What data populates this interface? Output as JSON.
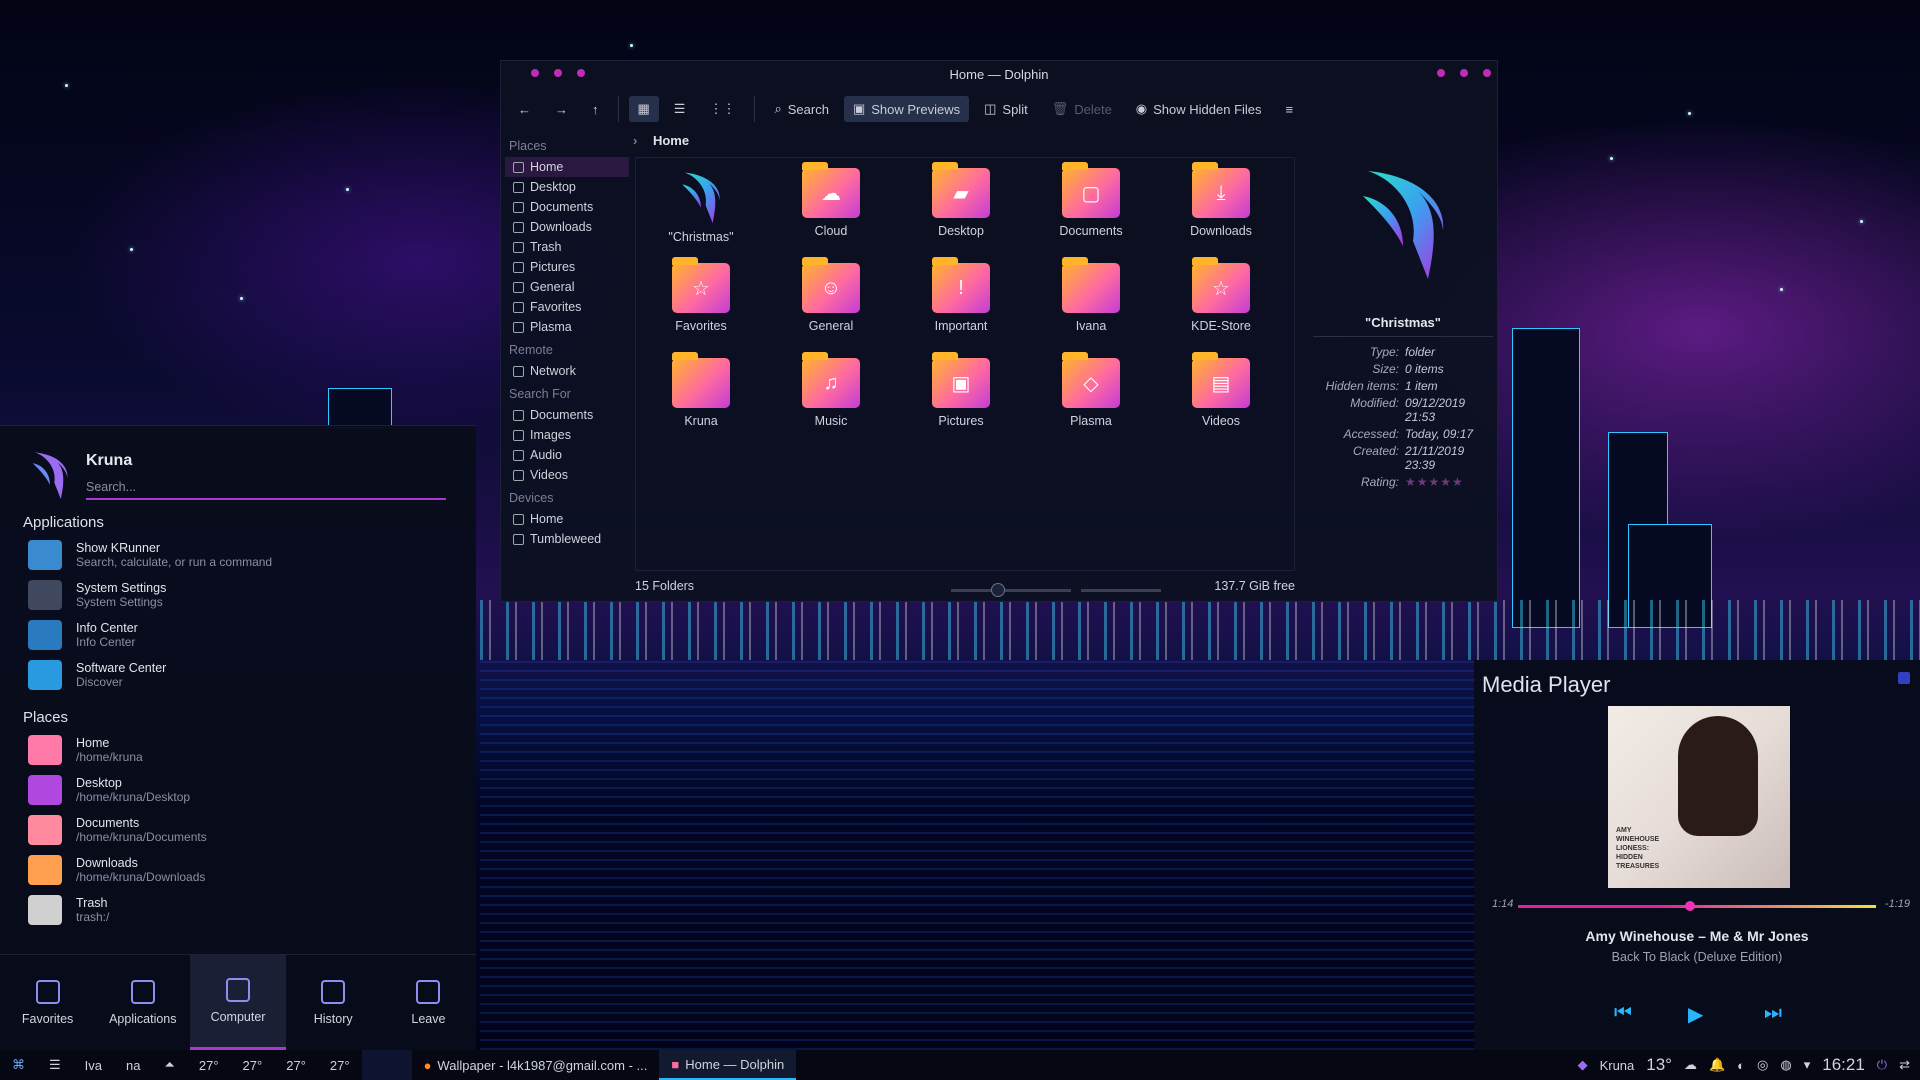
{
  "dolphin": {
    "window_title": "Home — Dolphin",
    "toolbar": {
      "search": "Search",
      "show_previews": "Show Previews",
      "split": "Split",
      "delete": "Delete",
      "show_hidden": "Show Hidden Files"
    },
    "breadcrumb": "Home",
    "places_sections": [
      {
        "title": "Places",
        "items": [
          "Home",
          "Desktop",
          "Documents",
          "Downloads",
          "Trash",
          "Pictures",
          "General",
          "Favorites",
          "Plasma"
        ]
      },
      {
        "title": "Remote",
        "items": [
          "Network"
        ]
      },
      {
        "title": "Search For",
        "items": [
          "Documents",
          "Images",
          "Audio",
          "Videos"
        ]
      },
      {
        "title": "Devices",
        "items": [
          "Home",
          "Tumbleweed"
        ]
      }
    ],
    "files": [
      {
        "name": "\"Christmas\"",
        "icon": "kde-logo-icon"
      },
      {
        "name": "Cloud",
        "icon": "cloud-icon"
      },
      {
        "name": "Desktop",
        "icon": "desktop-icon"
      },
      {
        "name": "Documents",
        "icon": "document-icon"
      },
      {
        "name": "Downloads",
        "icon": "download-icon"
      },
      {
        "name": "Favorites",
        "icon": "star-icon"
      },
      {
        "name": "General",
        "icon": "users-icon"
      },
      {
        "name": "Important",
        "icon": "exclamation-icon"
      },
      {
        "name": "Ivana",
        "icon": "folder-icon"
      },
      {
        "name": "KDE-Store",
        "icon": "star-icon"
      },
      {
        "name": "Kruna",
        "icon": "folder-icon"
      },
      {
        "name": "Music",
        "icon": "music-icon"
      },
      {
        "name": "Pictures",
        "icon": "image-icon"
      },
      {
        "name": "Plasma",
        "icon": "plasma-icon"
      },
      {
        "name": "Videos",
        "icon": "film-icon"
      }
    ],
    "status_left": "15 Folders",
    "status_right": "137.7 GiB free",
    "info": {
      "title": "\"Christmas\"",
      "rows": [
        {
          "k": "Type:",
          "v": "folder"
        },
        {
          "k": "Size:",
          "v": "0 items"
        },
        {
          "k": "Hidden items:",
          "v": "1 item"
        },
        {
          "k": "Modified:",
          "v": "09/12/2019 21:53"
        },
        {
          "k": "Accessed:",
          "v": "Today, 09:17"
        },
        {
          "k": "Created:",
          "v": "21/11/2019 23:39"
        }
      ],
      "rating_label": "Rating:",
      "rating_value": 0
    }
  },
  "kickoff": {
    "user": "Kruna",
    "search_placeholder": "Search...",
    "sections": [
      {
        "title": "Applications",
        "items": [
          {
            "name": "Show KRunner",
            "desc": "Search, calculate, or run a command"
          },
          {
            "name": "System Settings",
            "desc": "System Settings"
          },
          {
            "name": "Info Center",
            "desc": "Info Center"
          },
          {
            "name": "Software Center",
            "desc": "Discover"
          }
        ]
      },
      {
        "title": "Places",
        "items": [
          {
            "name": "Home",
            "desc": "/home/kruna"
          },
          {
            "name": "Desktop",
            "desc": "/home/kruna/Desktop"
          },
          {
            "name": "Documents",
            "desc": "/home/kruna/Documents"
          },
          {
            "name": "Downloads",
            "desc": "/home/kruna/Downloads"
          },
          {
            "name": "Trash",
            "desc": "trash:/"
          }
        ]
      }
    ],
    "tabs": [
      "Favorites",
      "Applications",
      "Computer",
      "History",
      "Leave"
    ]
  },
  "media": {
    "title": "Media Player",
    "album_text": "AMY WINEHOUSE LIONESS: HIDDEN TREASURES",
    "elapsed": "1:14",
    "remaining": "-1:19",
    "progress": 0.48,
    "song": "Amy Winehouse – Me & Mr Jones",
    "album": "Back To Black (Deluxe Edition)"
  },
  "taskbar": {
    "pager": [
      "Iva",
      "na"
    ],
    "temps": [
      "27°",
      "27°",
      "27°",
      "27°"
    ],
    "tasks": [
      "Wallpaper - l4k1987@gmail.com - ...",
      "Home — Dolphin"
    ],
    "user": "Kruna",
    "weather": "13°",
    "clock": "16:21"
  }
}
